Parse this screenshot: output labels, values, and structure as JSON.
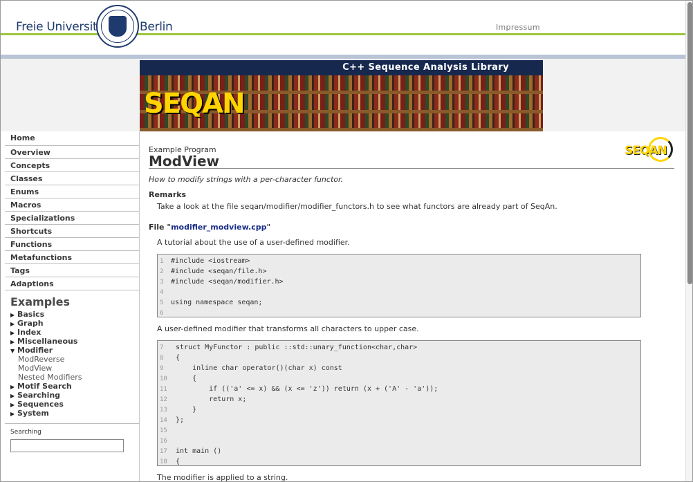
{
  "header": {
    "university_left": "Freie Universität",
    "university_right": "Berlin",
    "impressum": "Impressum"
  },
  "banner": {
    "title": "C++ Sequence Analysis Library",
    "logo": "SEQAN"
  },
  "sidebar": {
    "nav": [
      "Home",
      "Overview",
      "Concepts",
      "Classes",
      "Enums",
      "Macros",
      "Specializations",
      "Shortcuts",
      "Functions",
      "Metafunctions",
      "Tags",
      "Adaptions"
    ],
    "examples_title": "Examples",
    "examples": [
      {
        "label": "Basics",
        "expanded": false
      },
      {
        "label": "Graph",
        "expanded": false
      },
      {
        "label": "Index",
        "expanded": false
      },
      {
        "label": "Miscellaneous",
        "expanded": false
      },
      {
        "label": "Modifier",
        "expanded": true,
        "children": [
          "ModReverse",
          "ModView",
          "Nested Modifiers"
        ]
      },
      {
        "label": "Motif Search",
        "expanded": false
      },
      {
        "label": "Searching",
        "expanded": false
      },
      {
        "label": "Sequences",
        "expanded": false
      },
      {
        "label": "System",
        "expanded": false
      }
    ],
    "search_label": "Searching",
    "search_value": ""
  },
  "main": {
    "example_label": "Example Program",
    "title": "ModView",
    "logo": "SEQAN",
    "summary": "How to modify strings with a per-character functor.",
    "remarks_heading": "Remarks",
    "remarks_text": "Take a look at the file seqan/modifier/modifier_functors.h to see what functors are already part of SeqAn.",
    "file_prefix": "File \"",
    "file_name": "modifier_modview.cpp",
    "file_suffix": "\"",
    "desc1": "A tutorial about the use of a user-defined modifier.",
    "code1": [
      {
        "n": "1",
        "text": "#include <iostream>"
      },
      {
        "n": "2",
        "text": "#include <seqan/file.h>"
      },
      {
        "n": "3",
        "text": "#include <seqan/modifier.h>"
      },
      {
        "n": "4",
        "text": ""
      },
      {
        "n": "5",
        "text": "using namespace seqan;"
      },
      {
        "n": "6",
        "text": ""
      }
    ],
    "desc2": "A user-defined modifier that transforms all characters to upper case.",
    "code2": [
      {
        "n": "7",
        "text": "struct MyFunctor : public ::std::unary_function<char,char>"
      },
      {
        "n": "8",
        "text": "{"
      },
      {
        "n": "9",
        "text": "    inline char operator()(char x) const"
      },
      {
        "n": "10",
        "text": "    {"
      },
      {
        "n": "11",
        "text": "        if (('a' <= x) && (x <= 'z')) return (x + ('A' - 'a'));"
      },
      {
        "n": "12",
        "text": "        return x;"
      },
      {
        "n": "13",
        "text": "    }"
      },
      {
        "n": "14",
        "text": "};"
      },
      {
        "n": "15",
        "text": ""
      },
      {
        "n": "16",
        "text": ""
      },
      {
        "n": "17",
        "text": "int main ()"
      },
      {
        "n": "18",
        "text": "{"
      }
    ],
    "desc3": "The modifier is applied to a string."
  },
  "colors": {
    "fu_blue": "#1e3a6e",
    "fu_green": "#9bc53d",
    "banner_navy": "#17284f",
    "link": "#1a2f8a",
    "logo_yellow": "#ffd400"
  }
}
